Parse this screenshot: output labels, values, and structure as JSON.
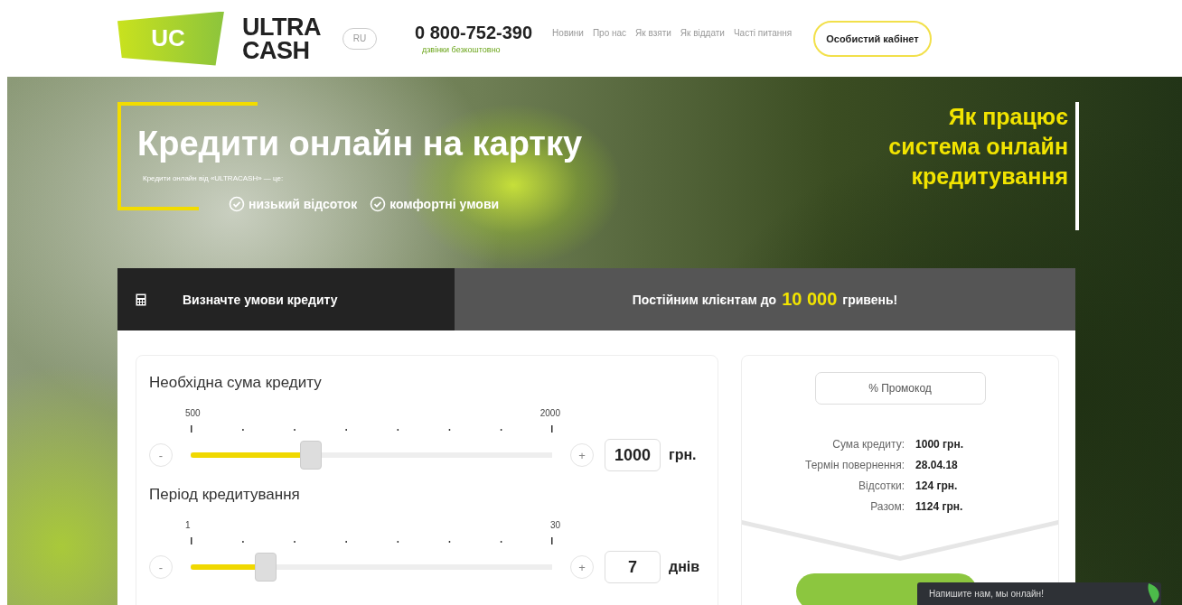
{
  "header": {
    "logo": {
      "mark": "UC",
      "line_1": "ULTRA",
      "line_2": "CASH"
    },
    "language": "RU",
    "phone": "0 800-752-390",
    "phone_note": "дзвінки безкоштовно",
    "nav": [
      {
        "label": "Новини"
      },
      {
        "label": "Про нас"
      },
      {
        "label": "Як взяти"
      },
      {
        "label": "Як віддати"
      },
      {
        "label": "Часті питання"
      }
    ],
    "cabinet_button": "Особистий кабінет"
  },
  "hero": {
    "title": "Кредити онлайн на картку",
    "subtitle": "Кредити онлайн від «ULTRACASH» — це:",
    "benefits": [
      "низький відсоток",
      "комфортні умови"
    ],
    "how_it_works": [
      "Як працює",
      "система онлайн",
      "кредитування"
    ]
  },
  "calculator": {
    "header": "Визначте умови кредиту",
    "promo_banner": {
      "before": "Постійним клієнтам до",
      "amount": "10 000",
      "after": "гривень!"
    },
    "sliders": [
      {
        "label": "Необхідна сума кредиту",
        "min": "500",
        "max": "2000",
        "level": 0.333,
        "value": "1000",
        "unit": "грн.",
        "minus": "-",
        "plus": "+"
      },
      {
        "label": "Період кредитування",
        "min": "1",
        "max": "30",
        "level": 0.207,
        "value": "7",
        "unit": "днів",
        "minus": "-",
        "plus": "+"
      }
    ],
    "promo_code": "% Промокод",
    "summary": [
      {
        "label": "Сума кредиту:",
        "value": "1000 грн."
      },
      {
        "label": "Термін повернення:",
        "value": "28.04.18"
      },
      {
        "label": "Відсотки:",
        "value": "124 грн."
      },
      {
        "label": "Разом:",
        "value": "1124 грн."
      }
    ]
  },
  "chat": {
    "text": "Напишите нам, мы онлайн!"
  }
}
